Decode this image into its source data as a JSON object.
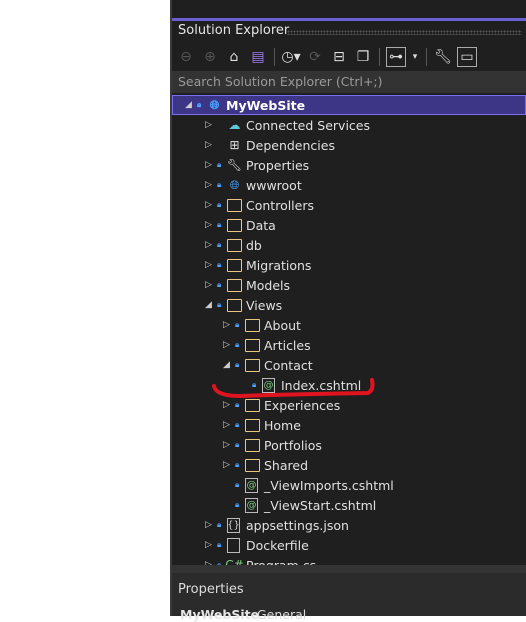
{
  "panel": {
    "title": "Solution Explorer",
    "search_placeholder": "Search Solution Explorer (Ctrl+;)"
  },
  "toolbar": [
    "back-icon",
    "forward-icon",
    "home-icon",
    "switch-views-icon",
    "pending-changes-filter-icon",
    "sync-icon",
    "collapse-all-icon",
    "show-all-files-icon",
    "view-options-icon",
    "properties-wrench-icon",
    "preview-selected-icon"
  ],
  "tree": [
    {
      "label": "MyWebSite",
      "level": 0,
      "arrow": "open",
      "lock": true,
      "icon": "web-project",
      "selected": true
    },
    {
      "label": "Connected Services",
      "level": 1,
      "arrow": "closed",
      "lock": false,
      "icon": "cloud"
    },
    {
      "label": "Dependencies",
      "level": 1,
      "arrow": "closed",
      "lock": false,
      "icon": "dependencies"
    },
    {
      "label": "Properties",
      "level": 1,
      "arrow": "closed",
      "lock": true,
      "icon": "properties-folder"
    },
    {
      "label": "wwwroot",
      "level": 1,
      "arrow": "closed",
      "lock": true,
      "icon": "globe"
    },
    {
      "label": "Controllers",
      "level": 1,
      "arrow": "closed",
      "lock": true,
      "icon": "folder"
    },
    {
      "label": "Data",
      "level": 1,
      "arrow": "closed",
      "lock": true,
      "icon": "folder"
    },
    {
      "label": "db",
      "level": 1,
      "arrow": "closed",
      "lock": true,
      "icon": "folder"
    },
    {
      "label": "Migrations",
      "level": 1,
      "arrow": "closed",
      "lock": true,
      "icon": "folder"
    },
    {
      "label": "Models",
      "level": 1,
      "arrow": "closed",
      "lock": true,
      "icon": "folder"
    },
    {
      "label": "Views",
      "level": 1,
      "arrow": "open",
      "lock": true,
      "icon": "folder-open"
    },
    {
      "label": "About",
      "level": 2,
      "arrow": "closed",
      "lock": true,
      "icon": "folder"
    },
    {
      "label": "Articles",
      "level": 2,
      "arrow": "closed",
      "lock": true,
      "icon": "folder"
    },
    {
      "label": "Contact",
      "level": 2,
      "arrow": "open",
      "lock": true,
      "icon": "folder-open"
    },
    {
      "label": "Index.cshtml",
      "level": 3,
      "arrow": "none",
      "lock": true,
      "icon": "razor"
    },
    {
      "label": "Experiences",
      "level": 2,
      "arrow": "closed",
      "lock": true,
      "icon": "folder"
    },
    {
      "label": "Home",
      "level": 2,
      "arrow": "closed",
      "lock": true,
      "icon": "folder"
    },
    {
      "label": "Portfolios",
      "level": 2,
      "arrow": "closed",
      "lock": true,
      "icon": "folder"
    },
    {
      "label": "Shared",
      "level": 2,
      "arrow": "closed",
      "lock": true,
      "icon": "folder"
    },
    {
      "label": "_ViewImports.cshtml",
      "level": 2,
      "arrow": "none",
      "lock": true,
      "icon": "razor"
    },
    {
      "label": "_ViewStart.cshtml",
      "level": 2,
      "arrow": "none",
      "lock": true,
      "icon": "razor"
    },
    {
      "label": "appsettings.json",
      "level": 1,
      "arrow": "closed",
      "lock": true,
      "icon": "json"
    },
    {
      "label": "Dockerfile",
      "level": 1,
      "arrow": "closed",
      "lock": true,
      "icon": "file"
    },
    {
      "label": "Program.cs",
      "level": 1,
      "arrow": "closed",
      "lock": true,
      "icon": "csharp"
    }
  ],
  "properties": {
    "title": "Properties",
    "object": "MyWebSite",
    "category": "General"
  },
  "colors": {
    "accent": "#6b5fd3",
    "selection": "#3d3585",
    "annotation": "#e0141e"
  }
}
